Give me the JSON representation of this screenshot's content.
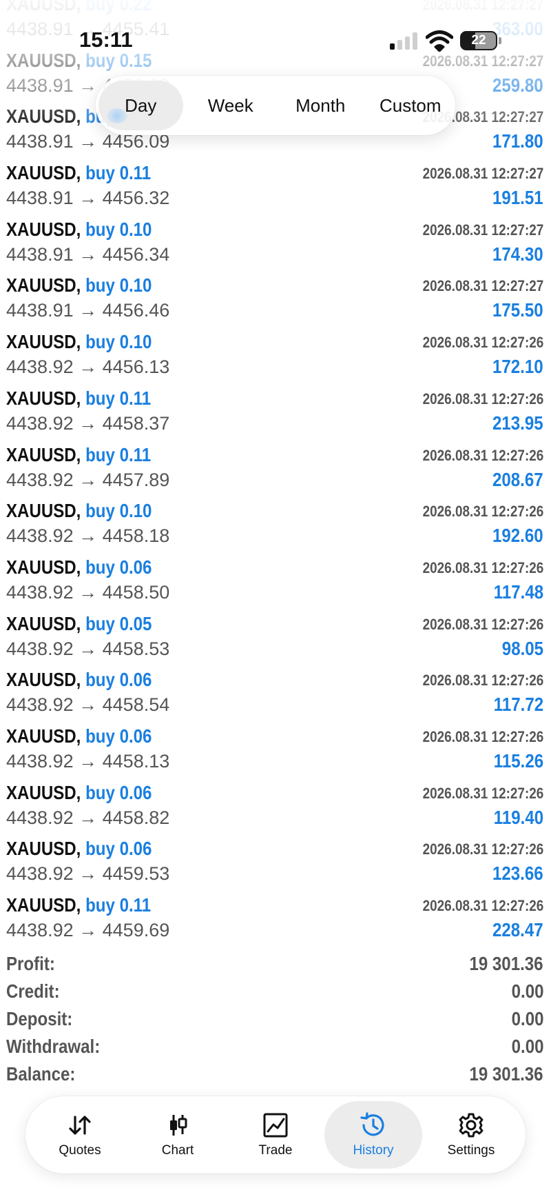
{
  "status_bar": {
    "time": "15:11",
    "battery": "22",
    "icons": [
      "signal-icon",
      "wifi-icon",
      "battery-icon"
    ]
  },
  "period_tabs": {
    "items": [
      "Day",
      "Week",
      "Month",
      "Custom"
    ],
    "selected": "Day"
  },
  "colors": {
    "accent": "#1a7fe0",
    "symbol": "#111111",
    "secondary_text": "#555555"
  },
  "trades": [
    {
      "symbol": "XAUUSD,",
      "side": "buy 0.22",
      "time": "2026.08.31 12:27:27",
      "open": "4438.91",
      "close": "4455.41",
      "profit": "363.00"
    },
    {
      "symbol": "XAUUSD,",
      "side": "buy 0.15",
      "time": "2026.08.31 12:27:27",
      "open": "4438.91",
      "close": "4456.23",
      "profit": "259.80"
    },
    {
      "symbol": "XAUUSD,",
      "side": "buy 0.10",
      "time": "2026.08.31 12:27:27",
      "open": "4438.91",
      "close": "4456.09",
      "profit": "171.80"
    },
    {
      "symbol": "XAUUSD,",
      "side": "buy 0.11",
      "time": "2026.08.31 12:27:27",
      "open": "4438.91",
      "close": "4456.32",
      "profit": "191.51"
    },
    {
      "symbol": "XAUUSD,",
      "side": "buy 0.10",
      "time": "2026.08.31 12:27:27",
      "open": "4438.91",
      "close": "4456.34",
      "profit": "174.30"
    },
    {
      "symbol": "XAUUSD,",
      "side": "buy 0.10",
      "time": "2026.08.31 12:27:27",
      "open": "4438.91",
      "close": "4456.46",
      "profit": "175.50"
    },
    {
      "symbol": "XAUUSD,",
      "side": "buy 0.10",
      "time": "2026.08.31 12:27:26",
      "open": "4438.92",
      "close": "4456.13",
      "profit": "172.10"
    },
    {
      "symbol": "XAUUSD,",
      "side": "buy 0.11",
      "time": "2026.08.31 12:27:26",
      "open": "4438.92",
      "close": "4458.37",
      "profit": "213.95"
    },
    {
      "symbol": "XAUUSD,",
      "side": "buy 0.11",
      "time": "2026.08.31 12:27:26",
      "open": "4438.92",
      "close": "4457.89",
      "profit": "208.67"
    },
    {
      "symbol": "XAUUSD,",
      "side": "buy 0.10",
      "time": "2026.08.31 12:27:26",
      "open": "4438.92",
      "close": "4458.18",
      "profit": "192.60"
    },
    {
      "symbol": "XAUUSD,",
      "side": "buy 0.06",
      "time": "2026.08.31 12:27:26",
      "open": "4438.92",
      "close": "4458.50",
      "profit": "117.48"
    },
    {
      "symbol": "XAUUSD,",
      "side": "buy 0.05",
      "time": "2026.08.31 12:27:26",
      "open": "4438.92",
      "close": "4458.53",
      "profit": "98.05"
    },
    {
      "symbol": "XAUUSD,",
      "side": "buy 0.06",
      "time": "2026.08.31 12:27:26",
      "open": "4438.92",
      "close": "4458.54",
      "profit": "117.72"
    },
    {
      "symbol": "XAUUSD,",
      "side": "buy 0.06",
      "time": "2026.08.31 12:27:26",
      "open": "4438.92",
      "close": "4458.13",
      "profit": "115.26"
    },
    {
      "symbol": "XAUUSD,",
      "side": "buy 0.06",
      "time": "2026.08.31 12:27:26",
      "open": "4438.92",
      "close": "4458.82",
      "profit": "119.40"
    },
    {
      "symbol": "XAUUSD,",
      "side": "buy 0.06",
      "time": "2026.08.31 12:27:26",
      "open": "4438.92",
      "close": "4459.53",
      "profit": "123.66"
    },
    {
      "symbol": "XAUUSD,",
      "side": "buy 0.11",
      "time": "2026.08.31 12:27:26",
      "open": "4438.92",
      "close": "4459.69",
      "profit": "228.47"
    }
  ],
  "arrow": "→",
  "summary": [
    {
      "label": "Profit:",
      "value": "19 301.36"
    },
    {
      "label": "Credit:",
      "value": "0.00"
    },
    {
      "label": "Deposit:",
      "value": "0.00"
    },
    {
      "label": "Withdrawal:",
      "value": "0.00"
    },
    {
      "label": "Balance:",
      "value": "19 301.36"
    }
  ],
  "bottom_nav": {
    "items": [
      {
        "label": "Quotes",
        "icon": "quotes-arrows-icon"
      },
      {
        "label": "Chart",
        "icon": "candlestick-icon"
      },
      {
        "label": "Trade",
        "icon": "trade-chart-icon"
      },
      {
        "label": "History",
        "icon": "history-clock-icon"
      },
      {
        "label": "Settings",
        "icon": "gear-icon"
      }
    ],
    "selected": "History"
  }
}
